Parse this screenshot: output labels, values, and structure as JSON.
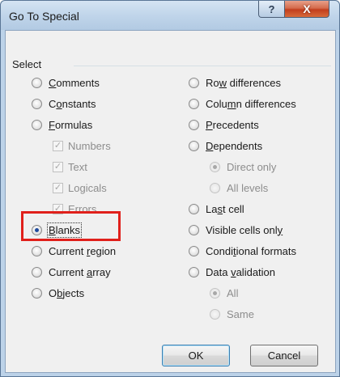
{
  "window": {
    "title": "Go To Special",
    "help_label": "?",
    "close_label": "X"
  },
  "group_label": "Select",
  "left_options": [
    {
      "pre": "",
      "u": "C",
      "post": "omments",
      "checked": false
    },
    {
      "pre": "C",
      "u": "o",
      "post": "nstants",
      "checked": false
    },
    {
      "pre": "",
      "u": "F",
      "post": "ormulas",
      "checked": false
    }
  ],
  "formula_checks": [
    {
      "label": "Numbers",
      "checked": true
    },
    {
      "label": "Text",
      "checked": true
    },
    {
      "label": "Logicals",
      "checked": true
    },
    {
      "label": "Errors",
      "checked": true
    }
  ],
  "left_options_2": [
    {
      "pre": "",
      "u": "B",
      "post": "lanks",
      "checked": true
    },
    {
      "pre": "Current ",
      "u": "r",
      "post": "egion",
      "checked": false
    },
    {
      "pre": "Current ",
      "u": "a",
      "post": "rray",
      "checked": false
    },
    {
      "pre": "O",
      "u": "b",
      "post": "jects",
      "checked": false
    }
  ],
  "right_options": [
    {
      "pre": "Ro",
      "u": "w",
      "post": " differences"
    },
    {
      "pre": "Colu",
      "u": "m",
      "post": "n differences"
    },
    {
      "pre": "",
      "u": "P",
      "post": "recedents"
    },
    {
      "pre": "",
      "u": "D",
      "post": "ependents"
    }
  ],
  "dependents_sub": [
    {
      "pre": "D",
      "u": "i",
      "post": "rect only",
      "checked": true
    },
    {
      "pre": "A",
      "u": "l",
      "post": "l levels",
      "checked": false
    }
  ],
  "right_options_2": [
    {
      "pre": "La",
      "u": "s",
      "post": "t cell"
    },
    {
      "pre": "Visible cells onl",
      "u": "y",
      "post": ""
    },
    {
      "pre": "Condi",
      "u": "t",
      "post": "ional formats"
    },
    {
      "pre": "Data ",
      "u": "v",
      "post": "alidation"
    }
  ],
  "validation_sub": [
    {
      "pre": "A",
      "u": "l",
      "post": "l",
      "checked": true
    },
    {
      "pre": "",
      "u": "S",
      "post": "ame",
      "checked": false
    }
  ],
  "buttons": {
    "ok": "OK",
    "cancel": "Cancel"
  },
  "colors": {
    "highlight": "#e0201b",
    "close": "#c23d1d",
    "titlebar": "#c0d5ea"
  }
}
